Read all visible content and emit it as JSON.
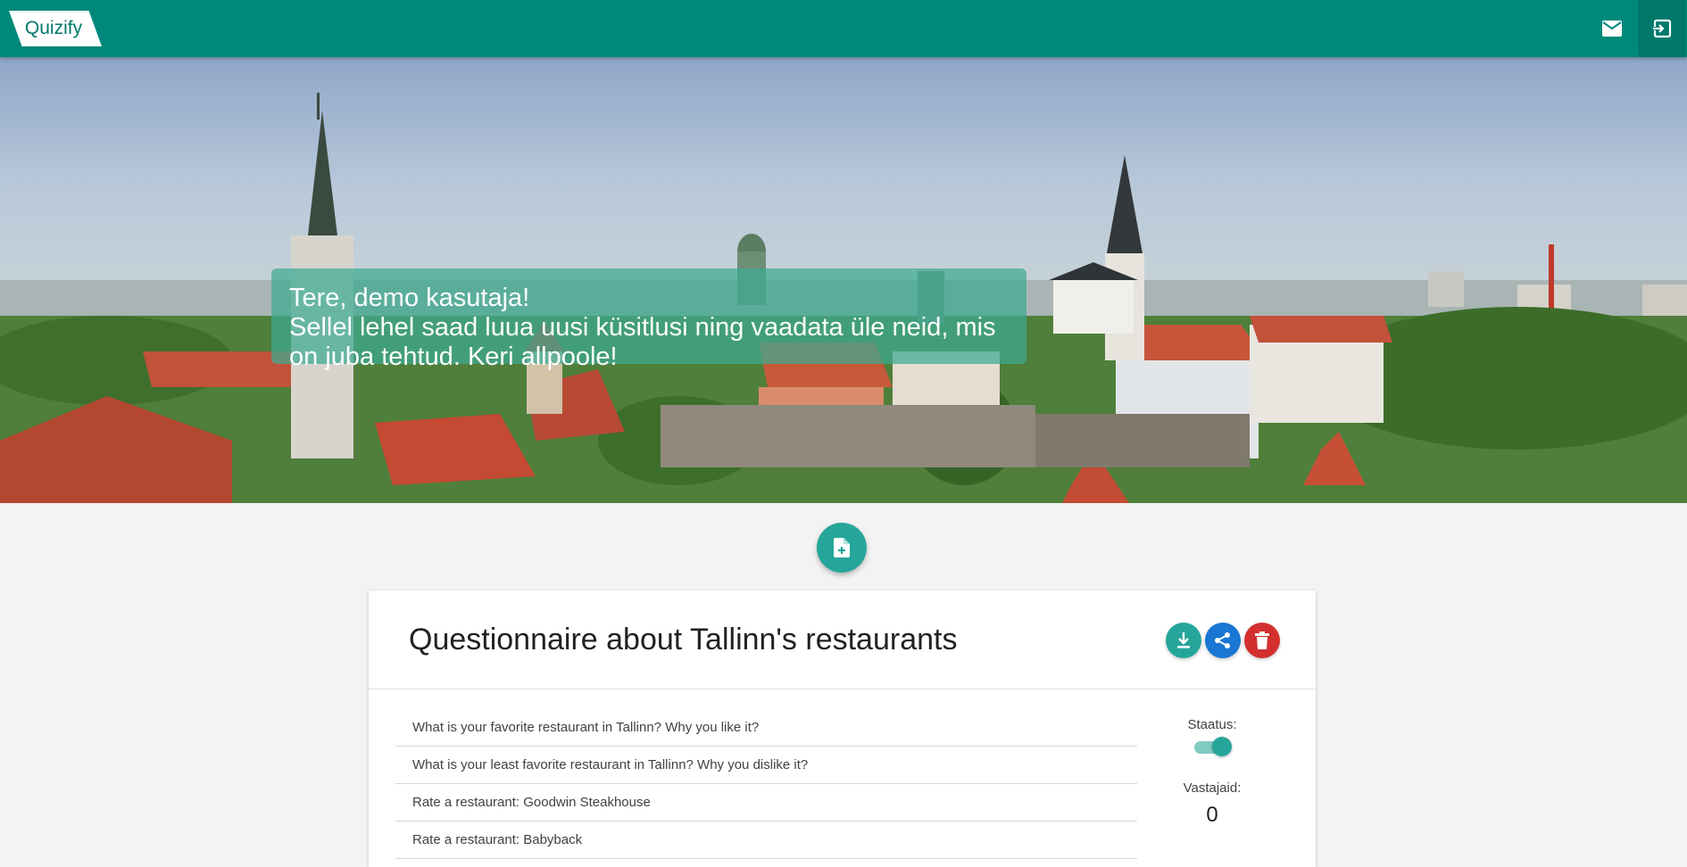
{
  "app": {
    "brand": "Quizify",
    "accent": "#00897b"
  },
  "nav": {
    "mail_icon": "mail-icon",
    "logout_icon": "logout-icon"
  },
  "hero": {
    "greeting": "Tere, demo kasutaja!",
    "message": "Sellel lehel saad luua uusi küsitlusi ning vaadata üle neid, mis on juba tehtud. Keri allpoole!"
  },
  "fab": {
    "icon": "new-document-icon"
  },
  "questionnaire": {
    "title": "Questionnaire about Tallinn's restaurants",
    "actions": {
      "download": "download-icon",
      "share": "share-icon",
      "delete": "delete-icon"
    },
    "questions": [
      "What is your favorite restaurant in Tallinn? Why you like it?",
      "What is your least favorite restaurant in Tallinn? Why you dislike it?",
      "Rate a restaurant: Goodwin Steakhouse",
      "Rate a restaurant: Babyback"
    ],
    "status_label": "Staatus:",
    "status_on": true,
    "respondents_label": "Vastajaid:",
    "respondents_count": "0"
  }
}
